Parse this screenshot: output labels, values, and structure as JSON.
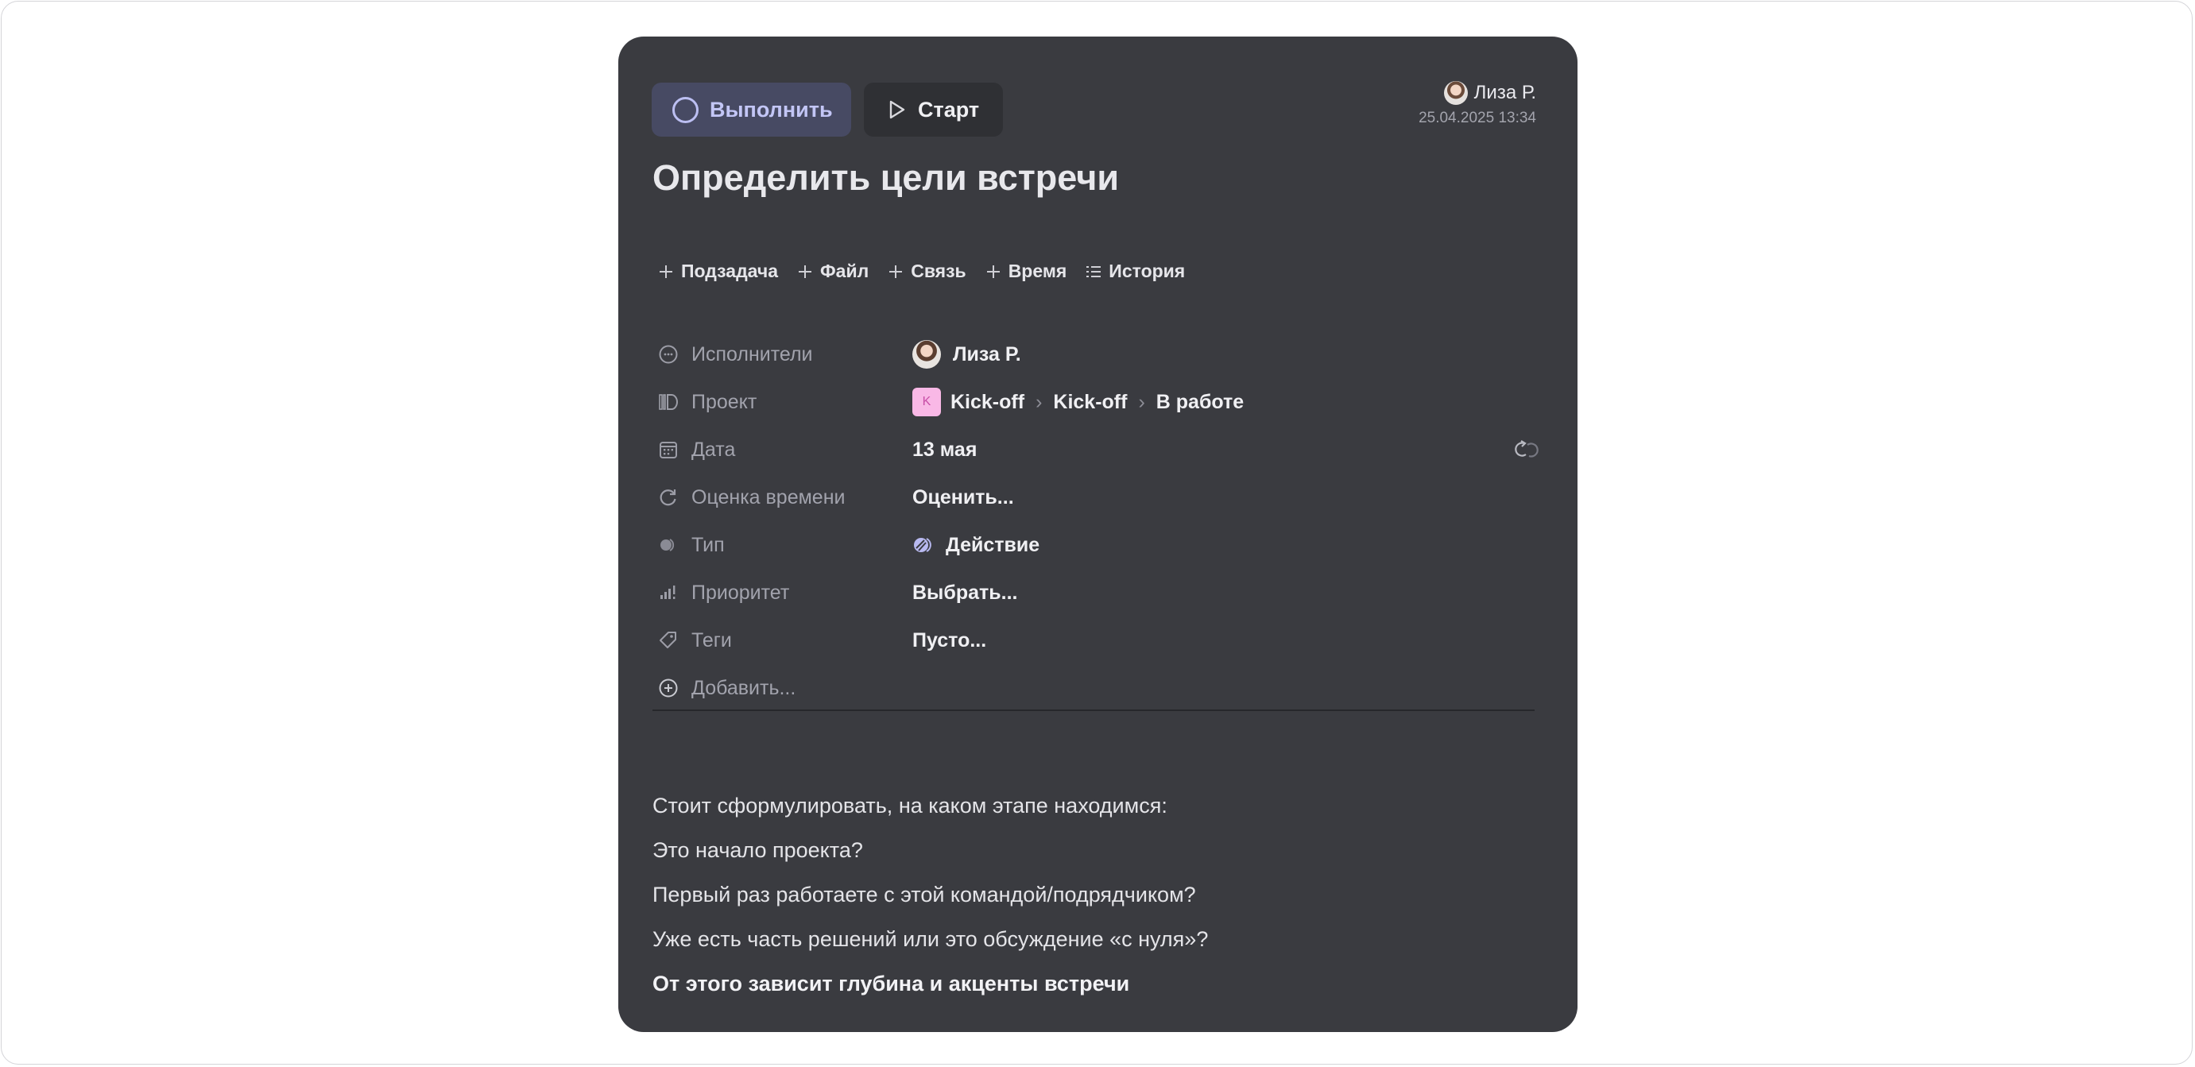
{
  "toolbar": {
    "complete_label": "Выполнить",
    "start_label": "Старт"
  },
  "author": {
    "name": "Лиза Р.",
    "date": "25.04.2025 13:34"
  },
  "task": {
    "title": "Определить цели встречи"
  },
  "actions": [
    {
      "label": "Подзадача",
      "icon": "plus-icon"
    },
    {
      "label": "Файл",
      "icon": "plus-icon"
    },
    {
      "label": "Связь",
      "icon": "plus-icon"
    },
    {
      "label": "Время",
      "icon": "plus-icon"
    },
    {
      "label": "История",
      "icon": "list-icon"
    }
  ],
  "properties": {
    "assignees": {
      "label": "Исполнители",
      "value": "Лиза Р."
    },
    "project": {
      "label": "Проект",
      "badge": "K",
      "path": [
        "Kick-off",
        "Kick-off",
        "В работе"
      ]
    },
    "date": {
      "label": "Дата",
      "value": "13 мая"
    },
    "estimate": {
      "label": "Оценка времени",
      "value": "Оценить..."
    },
    "type": {
      "label": "Тип",
      "value": "Действие"
    },
    "priority": {
      "label": "Приоритет",
      "value": "Выбрать..."
    },
    "tags": {
      "label": "Теги",
      "value": "Пусто..."
    },
    "add": {
      "label": "Добавить..."
    }
  },
  "description": {
    "lines": [
      "Стоит сформулировать, на каком этапе находимся:",
      "Это начало проекта?",
      "Первый раз работаете с этой командой/подрядчиком?",
      "Уже есть часть решений или это обсуждение «с нуля»?"
    ],
    "emphasis": "От этого зависит глубина и акценты встречи"
  },
  "colors": {
    "card_bg": "#3a3b40",
    "complete_bg": "#474a63",
    "complete_accent": "#c3c6f6",
    "project_badge": "#f9b8e6"
  }
}
